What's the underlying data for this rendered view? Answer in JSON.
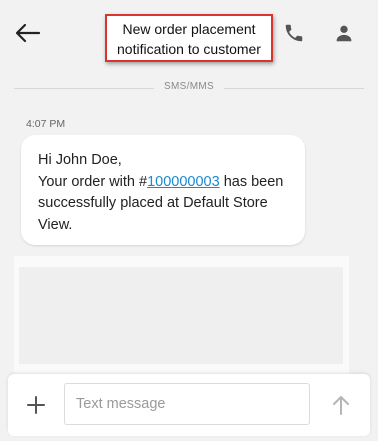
{
  "header": {
    "back_icon": "arrow-left-icon",
    "annotation_line1": "New order placement",
    "annotation_line2": "notification to customer",
    "call_icon": "phone-icon",
    "contact_icon": "person-icon"
  },
  "conversation": {
    "channel_label": "SMS/MMS",
    "timestamp": "4:07 PM",
    "message": {
      "greeting": "Hi John Doe,",
      "line_prefix": "Your order with #",
      "order_number": "100000003",
      "line_suffix": " has been successfully placed at Default Store View."
    }
  },
  "composer": {
    "add_icon": "plus-icon",
    "placeholder": "Text message",
    "send_icon": "send-arrow-up-icon"
  },
  "colors": {
    "link": "#1a8ad1",
    "annotation_border": "#d9352f",
    "background": "#f2f2f2"
  }
}
